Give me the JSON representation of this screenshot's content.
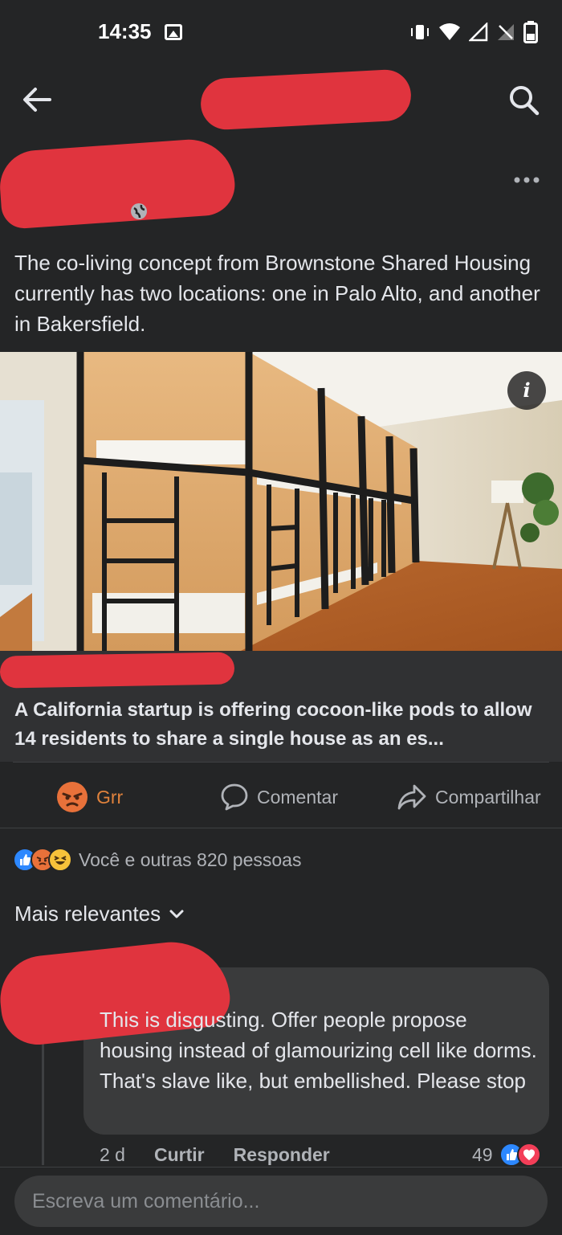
{
  "status_bar": {
    "time": "14:35",
    "icons": [
      "image-icon",
      "vibrate-icon",
      "wifi-icon",
      "signal-icon",
      "no-signal-icon",
      "battery-icon"
    ]
  },
  "top_bar": {
    "icons": [
      "back-arrow-icon",
      "search-icon"
    ]
  },
  "post": {
    "text": "The co-living concept from Brownstone Shared Housing currently has two locations: one in Palo Alto, and another in Bakersfield.",
    "audience_icon": "globe-icon",
    "more_icon": "more-dots-icon",
    "link_title": "A California startup is offering cocoon-like pods to allow 14 residents to share a single house as an es...",
    "info_label": "i"
  },
  "actions": {
    "reaction_label": "Grr",
    "comment_label": "Comentar",
    "share_label": "Compartilhar"
  },
  "reactions": {
    "summary": "Você e outras 820 pessoas",
    "icons": [
      "like-icon",
      "angry-icon",
      "haha-icon"
    ]
  },
  "comments_sort": {
    "label": "Mais relevantes"
  },
  "comment": {
    "text": "This is disgusting. Offer people propose housing instead of glamourizing cell like dorms. That's slave like, but embellished. Please stop",
    "time": "2 d",
    "like_label": "Curtir",
    "reply_label": "Responder",
    "reaction_count": "49"
  },
  "composer": {
    "placeholder": "Escreva um comentário..."
  },
  "colors": {
    "background": "#242526",
    "card": "#303133",
    "bubble": "#3a3b3c",
    "redaction": "#e0343e",
    "angry_orange": "#e0823c",
    "like_blue": "#2d88ff"
  }
}
